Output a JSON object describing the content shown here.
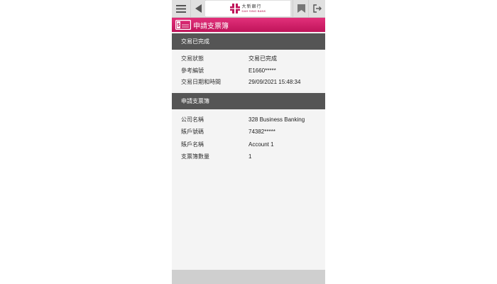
{
  "header": {
    "logo_zh": "大新銀行",
    "logo_en": "DAH SING BANK"
  },
  "icons": {
    "menu": "hamburger-menu-icon",
    "back": "back-arrow-icon",
    "logo": "dah-sing-logo-icon",
    "bookmark": "bookmark-icon",
    "logout": "logout-icon",
    "cheque": "cheque-book-icon"
  },
  "colors": {
    "brand_magenta": "#c0145a",
    "section_header": "#555555",
    "topbar": "#e0e0e0"
  },
  "page": {
    "title": "申請支票簿"
  },
  "transaction": {
    "header": "交易已完成",
    "rows": [
      {
        "label": "交易狀態",
        "value": "交易已完成"
      },
      {
        "label": "參考編號",
        "value": "E1660*****"
      },
      {
        "label": "交易日期和時間",
        "value": "29/09/2021 15:48:34"
      }
    ]
  },
  "cheque": {
    "header": "申請支票簿",
    "rows": [
      {
        "label": "公司名稱",
        "value": "328 Business Banking"
      },
      {
        "label": "賬戶號碼",
        "value": "74382*****"
      },
      {
        "label": "賬戶名稱",
        "value": "Account 1"
      },
      {
        "label": "支票簿數量",
        "value": "1"
      }
    ]
  }
}
